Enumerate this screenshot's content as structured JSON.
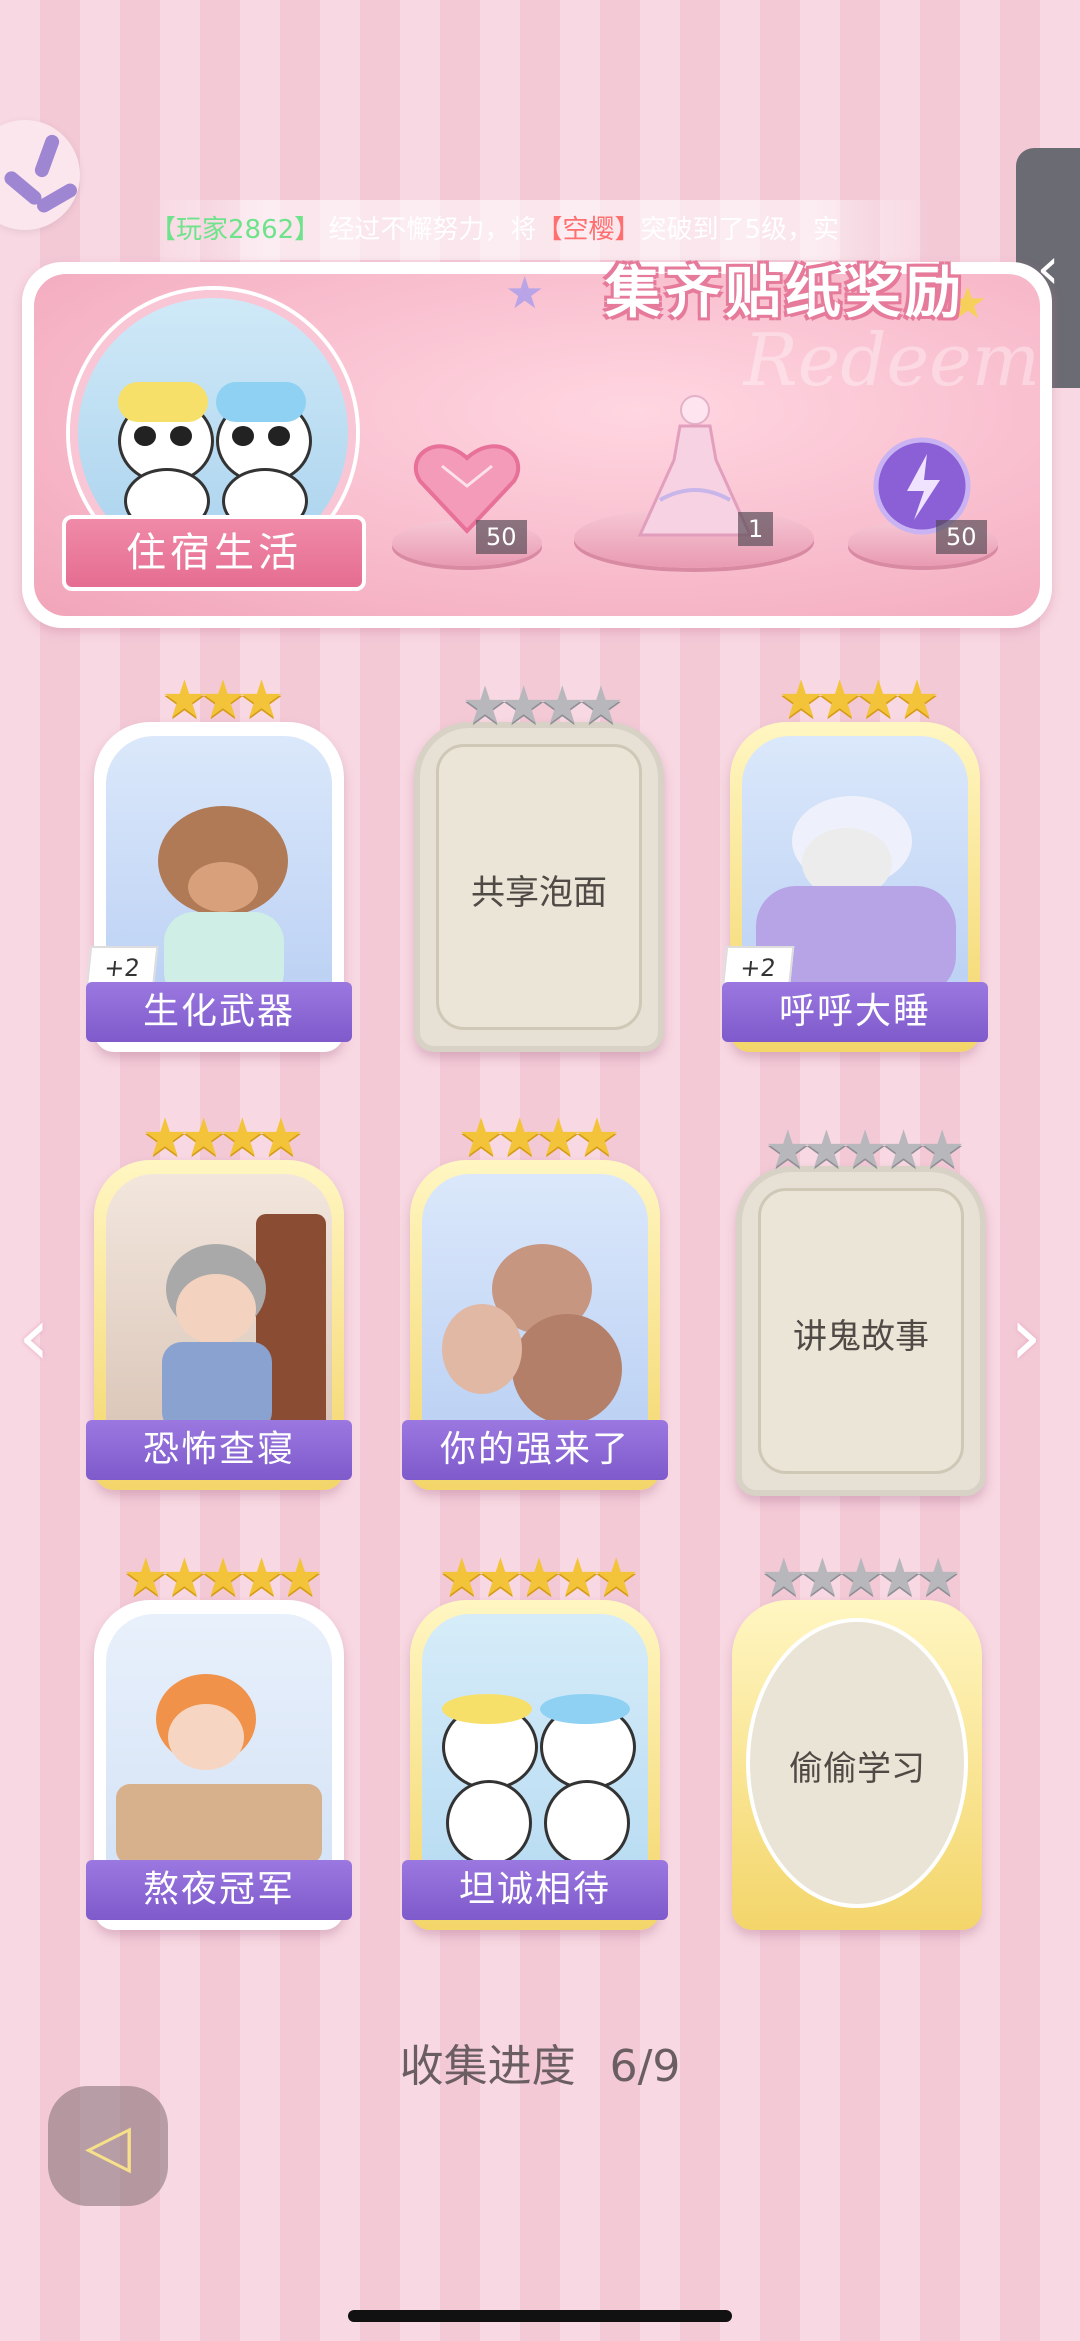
{
  "ticker": {
    "user": "【玩家2862】",
    "text1": " 经过不懈努力，将",
    "item": "【空樱】",
    "text2": "突破到了5级，实"
  },
  "banner": {
    "title": "集齐贴纸奖励",
    "bg_word": "Redeem",
    "album_label": "住宿生活",
    "rewards": [
      {
        "name": "heart-gem",
        "qty": "50"
      },
      {
        "name": "dress",
        "qty": "1"
      },
      {
        "name": "energy-orb",
        "qty": "50"
      }
    ]
  },
  "stickers": [
    {
      "name": "生化武器",
      "stars": 3,
      "max": 3,
      "unlocked": true,
      "bonus": "+2",
      "frame": "white"
    },
    {
      "name": "共享泡面",
      "stars": 0,
      "max": 4,
      "unlocked": false,
      "frame": "silver"
    },
    {
      "name": "呼呼大睡",
      "stars": 4,
      "max": 4,
      "unlocked": true,
      "bonus": "+2",
      "frame": "gold"
    },
    {
      "name": "恐怖查寝",
      "stars": 4,
      "max": 4,
      "unlocked": true,
      "frame": "gold"
    },
    {
      "name": "你的强来了",
      "stars": 4,
      "max": 4,
      "unlocked": true,
      "frame": "gold"
    },
    {
      "name": "讲鬼故事",
      "stars": 0,
      "max": 5,
      "unlocked": false,
      "frame": "silver"
    },
    {
      "name": "熬夜冠军",
      "stars": 5,
      "max": 5,
      "unlocked": true,
      "frame": "white"
    },
    {
      "name": "坦诚相待",
      "stars": 5,
      "max": 5,
      "unlocked": true,
      "frame": "gold"
    },
    {
      "name": "偷偷学习",
      "stars": 0,
      "max": 5,
      "unlocked": false,
      "frame": "gold-oval"
    }
  ],
  "progress": {
    "label": "收集进度",
    "value": "6/9"
  },
  "colors": {
    "accent_purple": "#7e5acb",
    "pink_bg": "#f8d8e2",
    "gold": "#f3c43a"
  }
}
